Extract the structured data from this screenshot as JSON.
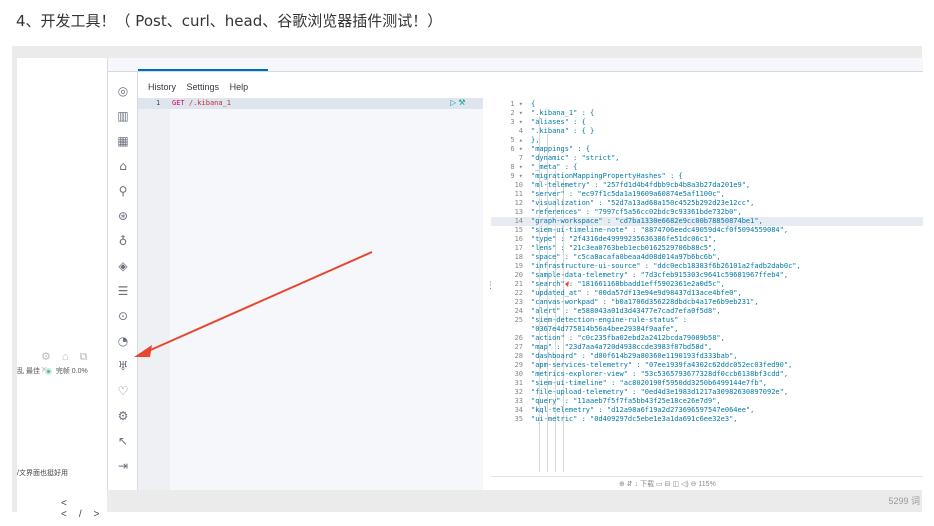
{
  "heading": "4、开发工具！（ Post、curl、head、谷歌浏览器插件测试！）",
  "left_strip": {
    "tools_glyphs": "⚙ ⌂ ⧉ ×",
    "zoom_left": "乱 最佳",
    "zoom_right": "完帧 0.0%",
    "hint": "/文界面也挺好用",
    "code_nav": "< </>"
  },
  "menu": {
    "history": "History",
    "settings": "Settings",
    "help": "Help"
  },
  "rail_icons": [
    "compass-icon",
    "chart-icon",
    "dashboard-icon",
    "bank-icon",
    "map-icon",
    "ml-icon",
    "apm-icon",
    "uptime-icon",
    "logs-icon",
    "heartbeat-icon",
    "graph-icon",
    "devtools-icon",
    "stack-monitoring-icon",
    "management-icon",
    "cursor-icon",
    "collapse-icon"
  ],
  "editor": {
    "line_number": "1",
    "method": "GET",
    "path": "/.kibana_1"
  },
  "output_lines": [
    {
      "n": "1 ▾",
      "t": "{"
    },
    {
      "n": "2 ▾",
      "t": "  \".kibana_1\" : {"
    },
    {
      "n": "3 ▾",
      "t": "    \"aliases\" : {"
    },
    {
      "n": "4",
      "t": "      \".kibana\" : { }"
    },
    {
      "n": "5 ▴",
      "t": "    },"
    },
    {
      "n": "6 ▾",
      "t": "    \"mappings\" : {"
    },
    {
      "n": "7",
      "t": "      \"dynamic\" : \"strict\","
    },
    {
      "n": "8 ▾",
      "t": "      \"_meta\" : {"
    },
    {
      "n": "9 ▾",
      "t": "        \"migrationMappingPropertyHashes\" : {"
    },
    {
      "n": "10",
      "t": "          \"ml-telemetry\" : \"257fd1d4b4fdbb9cb4b8a3b27da201e9\","
    },
    {
      "n": "11",
      "t": "          \"server\" : \"ec97f1c5da1a19609a60874e5af1100c\","
    },
    {
      "n": "12",
      "t": "          \"visualization\" : \"52d7a13ad68a150c4525b292d23e12cc\","
    },
    {
      "n": "13",
      "t": "          \"references\" : \"7997cf5a56cc02bdc9c93361bde732b0\","
    },
    {
      "n": "14",
      "t": "          \"graph-workspace\" : \"cd7ba1330e6682e9cc00b78850874be1\",",
      "hl": true
    },
    {
      "n": "15",
      "t": "          \"siem-ui-timeline-note\" : \"8874706eedc49059d4cf0f5094559084\","
    },
    {
      "n": "16",
      "t": "          \"type\" : \"2f4316de49999235636386fe51dc06c1\","
    },
    {
      "n": "17",
      "t": "          \"lens\" : \"21c3ea0763beb1ecb0162529706b88c5\","
    },
    {
      "n": "18",
      "t": "          \"space\" : \"c5ca8acafa0beaa4d08d014a97b6bc6b\","
    },
    {
      "n": "19",
      "t": "          \"infrastructure-ui-source\" : \"ddc0ecb18383f6b26101a2fadb2dab0c\","
    },
    {
      "n": "20",
      "t": "          \"sample-data-telemetry\" : \"7d3cfeb915303c9641c59681967ffeb4\","
    },
    {
      "n": "21",
      "t": "          \"search\" : \"181661168bbadd1eff5902361e2a0d5c\","
    },
    {
      "n": "22",
      "t": "          \"updated_at\" : \"00da57df13e94e9d98437d13ace4bfe0\","
    },
    {
      "n": "23",
      "t": "          \"canvas-workpad\" : \"b0a1706d356228dbdcb4a17e6b9eb231\","
    },
    {
      "n": "24",
      "t": "          \"alert\" : \"e588043a01d3d43477e7cad7efa0f5d8\","
    },
    {
      "n": "25",
      "t": "          \"siem-detection-engine-rule-status\" :"
    },
    {
      "n": "",
      "t": "            \"0367e4d775814b56a4bee29384f9aafe\","
    },
    {
      "n": "26",
      "t": "          \"action\" : \"c0c235fba02ebd2a2412bcda79009b58\","
    },
    {
      "n": "27",
      "t": "          \"map\" : \"23d7aa4a720d4938ccde3983f87bd58d\","
    },
    {
      "n": "28",
      "t": "          \"dashboard\" : \"d00f614b29a80360e1190193fd333bab\","
    },
    {
      "n": "29",
      "t": "          \"apm-services-telemetry\" : \"07ee1939fa4302c62ddc052ec03fed90\","
    },
    {
      "n": "30",
      "t": "          \"metrics-explorer-view\" : \"53c5365793677328df0ccb6138bf3cdd\","
    },
    {
      "n": "31",
      "t": "          \"siem-ui-timeline\" : \"ac8020190f5950dd3250b6499144e7fb\","
    },
    {
      "n": "32",
      "t": "          \"file-upload-telemetry\" : \"0ed4d3e1983d1217a30982630897092e\","
    },
    {
      "n": "33",
      "t": "          \"query\" : \"11aaeb7f5f7fa5bb43f25e18ce26e7d9\","
    },
    {
      "n": "34",
      "t": "          \"kql-telemetry\" : \"d12a98a6f19a2d273696597547e064ee\","
    },
    {
      "n": "35",
      "t": "          \"ui-metric\" : \"0d409297dc5ebe1e3a1da691c6ee32e3\","
    }
  ],
  "bottom_tools": "⊕  ⇵  ↓ 下载  ▭  ⊟  ◫  ◁)  ⊖  115%",
  "char_count": "5299 词"
}
